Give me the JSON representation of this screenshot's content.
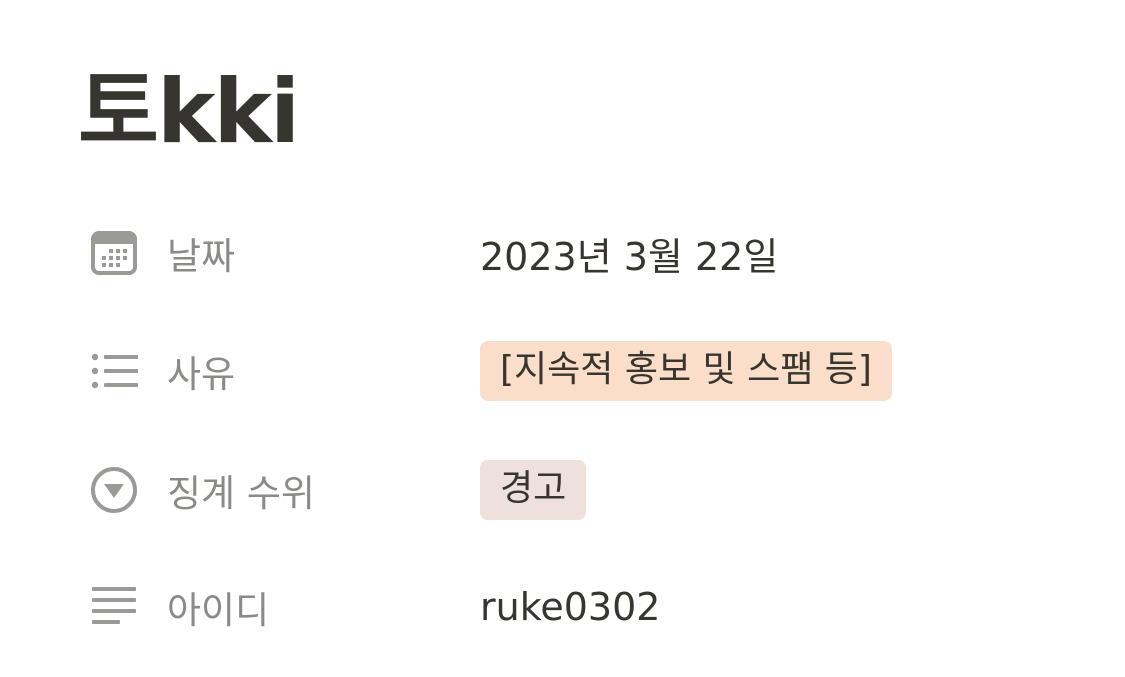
{
  "page": {
    "title": "토kki"
  },
  "properties": [
    {
      "label": "날짜",
      "icon": "calendar-icon",
      "type": "date",
      "value": "2023년 3월 22일"
    },
    {
      "label": "사유",
      "icon": "bulleted-list-icon",
      "type": "multi-select",
      "value": "[지속적 홍보 및 스팸 등]",
      "tag_color": "#fadec9"
    },
    {
      "label": "징계 수위",
      "icon": "select-chevron-icon",
      "type": "select",
      "value": "경고",
      "tag_color": "#eee0da"
    },
    {
      "label": "아이디",
      "icon": "text-lines-icon",
      "type": "text",
      "value": "ruke0302"
    }
  ],
  "colors": {
    "text": "#37352f",
    "label": "#8b8a86",
    "icon": "#9b9a97"
  }
}
